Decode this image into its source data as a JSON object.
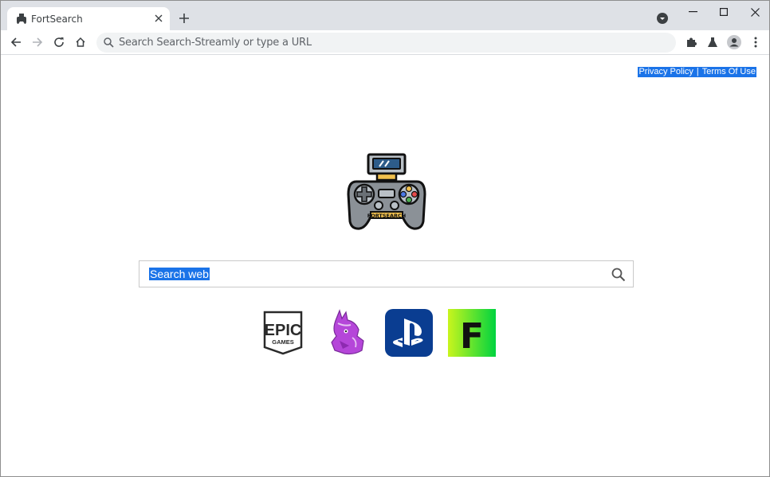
{
  "browser": {
    "tab_title": "FortSearch",
    "omnibox_placeholder": "Search Search-Streamly or type a URL"
  },
  "page": {
    "links": {
      "privacy": "Privacy Policy",
      "separator": "|",
      "terms": "Terms Of Use"
    },
    "logo_text": "FORTSEARCH",
    "search_text": "Search web",
    "shortcuts": [
      {
        "name": "Epic Games",
        "icon": "epic-games-icon",
        "label_top": "EPIC",
        "label_bottom": "GAMES"
      },
      {
        "name": "Llama",
        "icon": "llama-icon"
      },
      {
        "name": "PlayStation",
        "icon": "playstation-icon"
      },
      {
        "name": "Fortnite",
        "icon": "fortnite-icon",
        "label": "F"
      }
    ]
  },
  "colors": {
    "tabstrip": "#dee1e6",
    "highlight": "#1a73e8",
    "playstation": "#0a3d91",
    "fortnite_from": "#c9f51d",
    "fortnite_to": "#00d33f",
    "llama": "#b546d9"
  }
}
